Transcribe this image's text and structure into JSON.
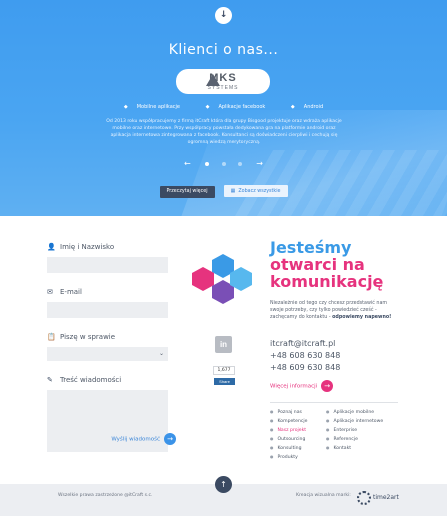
{
  "hero": {
    "top_arrow_icon": "↓",
    "title": "Klienci o nas...",
    "client_logo": {
      "main": "MKS",
      "sub": "SYSTEMS"
    },
    "tags": [
      {
        "icon": "tag-icon",
        "label": "Mobilne aplikacje"
      },
      {
        "icon": "tag-icon",
        "label": "Aplikacje facebook"
      },
      {
        "icon": "tag-icon",
        "label": "Android"
      }
    ],
    "description": "Od 2013 roku współpracujemy z firmą itCraft która dla grupy Bisgood projektuje oraz wdraża aplikacje mobilne oraz internetowe. Przy współpracy powstała dedykowana gra na platformie android oraz aplikacja internetowa zintegrowana z facebook. Konsultanci są doświadczeni cierpliwi i cechują się ogromną wiedzą merytoryczną.",
    "prev_arrow": "←",
    "next_arrow": "→",
    "slides_total": 3,
    "slide_active": 1,
    "btn_read_more": "Przeczytaj więcej",
    "btn_see_all": "Zobacz wszystkie"
  },
  "form": {
    "name_label": "Imię i Nazwisko",
    "name_value": "",
    "email_label": "E-mail",
    "email_value": "",
    "subject_label": "Piszę w sprawie",
    "subject_value": "",
    "message_label": "Treść wiadomości",
    "message_value": "",
    "send_label": "Wyślij wiadomość",
    "send_icon": "→"
  },
  "hexagons": {
    "colors": [
      "#3a9ae6",
      "#e6337e",
      "#7a4fb6",
      "#57b8ee"
    ]
  },
  "social": {
    "linkedin_label": "in",
    "share_count": "1,677",
    "share_label": "Share"
  },
  "contact": {
    "headline_line1": "Jesteśmy",
    "headline_line2": "otwarci na",
    "headline_line3": "komunikację",
    "intro_text": "Niezależnie od tego czy chcesz przedstawić nam swoje potrzeby, czy tylko powiedzieć cześć - zachęcamy do kontaktu -",
    "intro_bold": "odpowiemy napewno!",
    "email": "itcraft@itcraft.pl",
    "phone1": "+48 608 630 848",
    "phone2": "+48 609 630 848",
    "more_info": "Więcej informacji",
    "more_icon": "→",
    "links_col1": [
      "Poznaj nas",
      "Kompetencje",
      "Nasz projekt",
      "Outsourcing",
      "Konsulting",
      "Produkty"
    ],
    "links_col2": [
      "Aplikacje mobilne",
      "Aplikacje internetowe",
      "Enterprise",
      "Referencje",
      "Kontakt"
    ],
    "active_link": "Nasz projekt"
  },
  "footer": {
    "up_icon": "↑",
    "copyright": "Wszelkie prawa zastrzeżone @itCraft s.c.",
    "creation": "Kreacja wizualna marki:",
    "agency": "time2art"
  }
}
